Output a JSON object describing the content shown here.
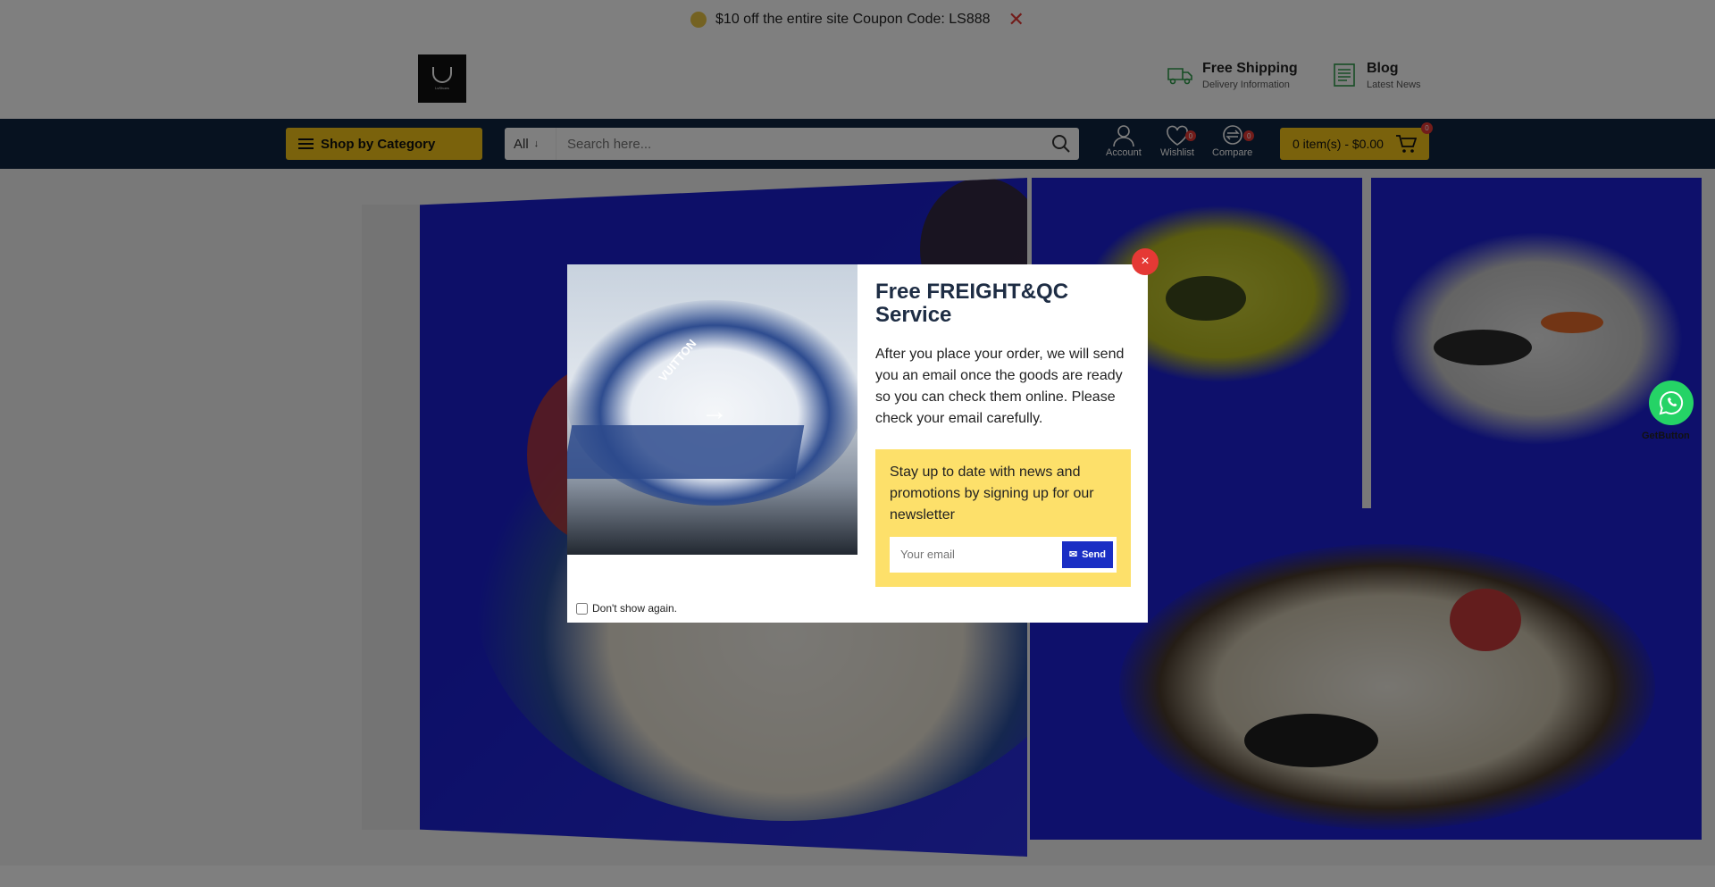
{
  "promo": {
    "text": "$10 off the entire site Coupon Code: LS888",
    "close": "✕"
  },
  "header": {
    "logo_text": "LvShoes",
    "shipping": {
      "title": "Free Shipping",
      "sub": "Delivery Information",
      "icon": "truck-icon"
    },
    "blog": {
      "title": "Blog",
      "sub": "Latest News",
      "icon": "document-icon"
    }
  },
  "nav": {
    "shop_by_category": "Shop by Category",
    "search_category": "All",
    "search_placeholder": "Search here...",
    "account": "Account",
    "wishlist": "Wishlist",
    "wishlist_count": "0",
    "compare": "Compare",
    "compare_count": "0",
    "cart": "0 item(s) - $0.00",
    "cart_count": "0"
  },
  "whatsapp": {
    "label": "GetButton"
  },
  "modal": {
    "title": "Free FREIGHT&QC Service",
    "description": "After you place your order, we will send you an email once the goods are ready so you can check them online. Please check your email carefully.",
    "newsletter_text": "Stay up to date with news and promotions by signing up for our newsletter",
    "email_placeholder": "Your email",
    "send": "Send",
    "dont_show": "Don't show again.",
    "close": "×",
    "image_text": "VUITTON"
  },
  "colors": {
    "accent": "#f5c518",
    "navbar": "#0f2440",
    "danger": "#e53935",
    "newsletter_bg": "#fde06a",
    "send_btn": "#1a2ec4"
  }
}
